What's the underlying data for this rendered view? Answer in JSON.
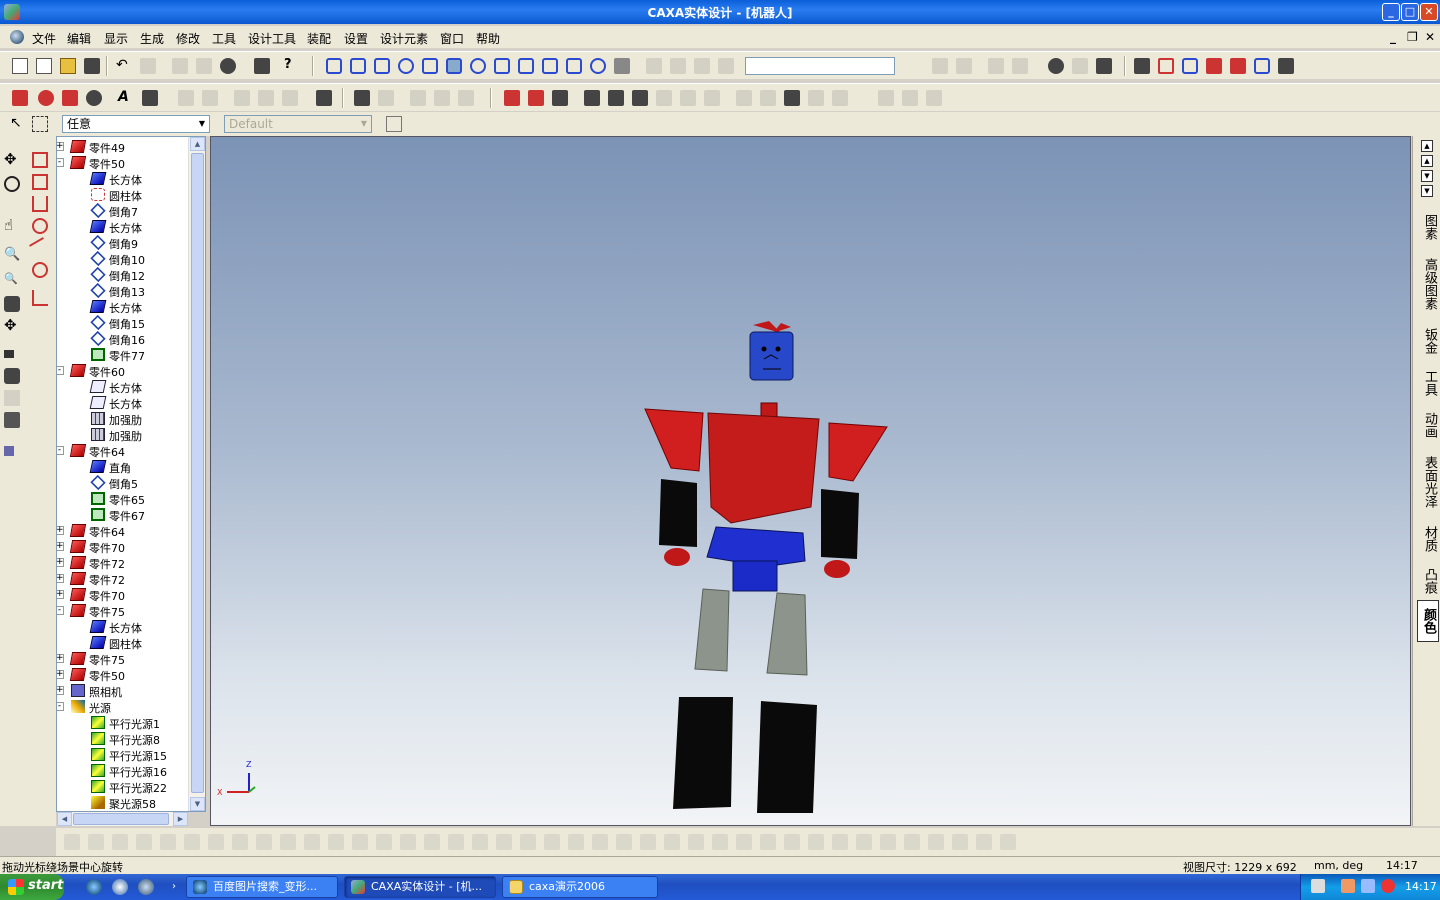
{
  "window": {
    "title": "CAXA实体设计 - [机器人]"
  },
  "menu": [
    "文件",
    "编辑",
    "显示",
    "生成",
    "修改",
    "工具",
    "设计工具",
    "装配",
    "设置",
    "设计元素",
    "窗口",
    "帮助"
  ],
  "filter": {
    "selection_mode": "任意",
    "style": "Default"
  },
  "tree": [
    {
      "label": "零件49",
      "level": 0,
      "icon": "part-icon",
      "expander": "+"
    },
    {
      "label": "零件50",
      "level": 0,
      "icon": "part-icon",
      "expander": "-"
    },
    {
      "label": "长方体",
      "level": 1,
      "icon": "box-icon"
    },
    {
      "label": "圆柱体",
      "level": 1,
      "icon": "cylinder-icon"
    },
    {
      "label": "倒角7",
      "level": 1,
      "icon": "chamfer-icon"
    },
    {
      "label": "长方体",
      "level": 1,
      "icon": "box-icon"
    },
    {
      "label": "倒角9",
      "level": 1,
      "icon": "chamfer-icon"
    },
    {
      "label": "倒角10",
      "level": 1,
      "icon": "chamfer-icon"
    },
    {
      "label": "倒角12",
      "level": 1,
      "icon": "chamfer-icon"
    },
    {
      "label": "倒角13",
      "level": 1,
      "icon": "chamfer-icon"
    },
    {
      "label": "长方体",
      "level": 1,
      "icon": "box-icon"
    },
    {
      "label": "倒角15",
      "level": 1,
      "icon": "chamfer-icon"
    },
    {
      "label": "倒角16",
      "level": 1,
      "icon": "chamfer-icon"
    },
    {
      "label": "零件77",
      "level": 1,
      "icon": "subpart-icon"
    },
    {
      "label": "零件60",
      "level": 0,
      "icon": "part-icon",
      "expander": "-"
    },
    {
      "label": "长方体",
      "level": 1,
      "icon": "outline-box-icon"
    },
    {
      "label": "长方体",
      "level": 1,
      "icon": "outline-box-icon"
    },
    {
      "label": "加强肋",
      "level": 1,
      "icon": "rib-icon"
    },
    {
      "label": "加强肋",
      "level": 1,
      "icon": "rib-icon"
    },
    {
      "label": "零件64",
      "level": 0,
      "icon": "part-icon",
      "expander": "-"
    },
    {
      "label": "直角",
      "level": 1,
      "icon": "box-icon"
    },
    {
      "label": "倒角5",
      "level": 1,
      "icon": "chamfer-icon"
    },
    {
      "label": "零件65",
      "level": 1,
      "icon": "subpart-icon"
    },
    {
      "label": "零件67",
      "level": 1,
      "icon": "subpart-icon"
    },
    {
      "label": "零件64",
      "level": 0,
      "icon": "part-icon",
      "expander": "+"
    },
    {
      "label": "零件70",
      "level": 0,
      "icon": "part-icon",
      "expander": "+"
    },
    {
      "label": "零件72",
      "level": 0,
      "icon": "part-icon",
      "expander": "+"
    },
    {
      "label": "零件72",
      "level": 0,
      "icon": "part-icon",
      "expander": "+"
    },
    {
      "label": "零件70",
      "level": 0,
      "icon": "part-icon",
      "expander": "+"
    },
    {
      "label": "零件75",
      "level": 0,
      "icon": "part-icon",
      "expander": "-"
    },
    {
      "label": "长方体",
      "level": 1,
      "icon": "box-icon"
    },
    {
      "label": "圆柱体",
      "level": 1,
      "icon": "box-icon"
    },
    {
      "label": "零件75",
      "level": 0,
      "icon": "part-icon",
      "expander": "+"
    },
    {
      "label": "零件50",
      "level": 0,
      "icon": "part-icon",
      "expander": "+"
    },
    {
      "label": "照相机",
      "level": 0,
      "icon": "camera-icon",
      "expander": "+"
    },
    {
      "label": "光源",
      "level": 0,
      "icon": "light-icon",
      "expander": "-"
    },
    {
      "label": "平行光源1",
      "level": 1,
      "icon": "parallel-light-icon"
    },
    {
      "label": "平行光源8",
      "level": 1,
      "icon": "parallel-light-icon"
    },
    {
      "label": "平行光源15",
      "level": 1,
      "icon": "parallel-light-icon"
    },
    {
      "label": "平行光源16",
      "level": 1,
      "icon": "parallel-light-icon"
    },
    {
      "label": "平行光源22",
      "level": 1,
      "icon": "parallel-light-icon"
    },
    {
      "label": "聚光源58",
      "level": 1,
      "icon": "spot-light-icon"
    }
  ],
  "right_tabs": [
    {
      "label": "图素",
      "active": false
    },
    {
      "label": "高级图素",
      "active": false
    },
    {
      "label": "钣金",
      "active": false
    },
    {
      "label": "工具",
      "active": false
    },
    {
      "label": "动画",
      "active": false
    },
    {
      "label": "表面光泽",
      "active": false
    },
    {
      "label": "材质",
      "active": false
    },
    {
      "label": "凸痕",
      "active": false
    },
    {
      "label": "颜色",
      "active": true
    }
  ],
  "axes": {
    "z": "Z",
    "x": "X"
  },
  "status": {
    "hint": "拖动光标绕场景中心旋转",
    "view_size": "视图尺寸: 1229 x  692",
    "units": "mm, deg",
    "time": "14:17"
  },
  "taskbar": {
    "start": "start",
    "tasks": [
      {
        "label": "百度图片搜索_变形...",
        "active": false,
        "icon": "browser-icon"
      },
      {
        "label": "CAXA实体设计 - [机...",
        "active": true,
        "icon": "caxa-icon"
      },
      {
        "label": "caxa演示2006",
        "active": false,
        "icon": "folder-icon"
      }
    ],
    "clock": "14:17"
  },
  "colors": {
    "robot_red": "#d11f1f",
    "robot_blue": "#1f2fd0",
    "robot_black": "#0a0a0a",
    "robot_gray": "#8c948c",
    "xp_blue": "#245ad8"
  }
}
